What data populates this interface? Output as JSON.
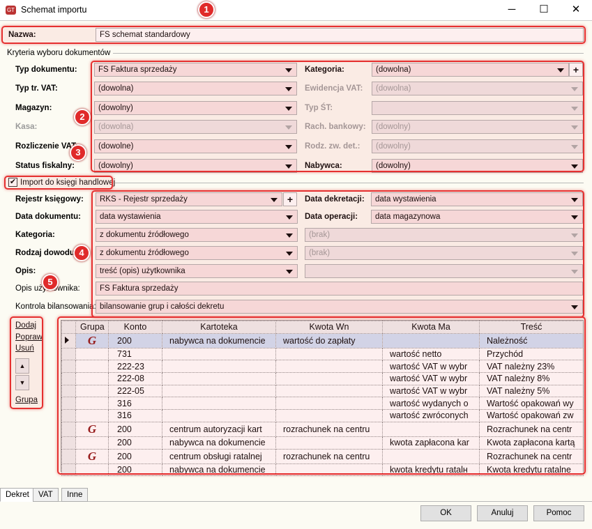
{
  "window": {
    "title": "Schemat importu",
    "minimize": "─",
    "maximize": "☐",
    "close": "✕"
  },
  "name": {
    "label": "Nazwa:",
    "value": "FS schemat standardowy"
  },
  "criteria": {
    "heading": "Kryteria wyboru dokumentów",
    "left": [
      {
        "label": "Typ dokumentu:",
        "value": "FS Faktura sprzedaży",
        "disabled": false
      },
      {
        "label": "Typ tr. VAT:",
        "value": "(dowolna)",
        "disabled": false
      },
      {
        "label": "Magazyn:",
        "value": "(dowolny)",
        "disabled": false
      },
      {
        "label": "Kasa:",
        "value": "(dowolna)",
        "disabled": true
      },
      {
        "label": "Rozliczenie VAT:",
        "value": "(dowolne)",
        "disabled": false
      },
      {
        "label": "Status fiskalny:",
        "value": "(dowolny)",
        "disabled": false
      }
    ],
    "right": [
      {
        "label": "Kategoria:",
        "value": "(dowolna)",
        "disabled": false
      },
      {
        "label": "Ewidencja VAT:",
        "value": "(dowolna)",
        "disabled": true
      },
      {
        "label": "Typ ŚT:",
        "value": "",
        "disabled": true
      },
      {
        "label": "Rach. bankowy:",
        "value": "(dowolny)",
        "disabled": true
      },
      {
        "label": "Rodz. zw. det.:",
        "value": "(dowolny)",
        "disabled": true
      },
      {
        "label": "Nabywca:",
        "value": "(dowolny)",
        "disabled": false
      }
    ],
    "plus": "+"
  },
  "import": {
    "label": "Import do księgi handlowej",
    "checked": true,
    "left": [
      {
        "label": "Rejestr księgowy:",
        "value": "RKS - Rejestr sprzedaży"
      },
      {
        "label": "Data dokumentu:",
        "value": "data wystawienia"
      },
      {
        "label": "Kategoria:",
        "value": "z dokumentu źródłowego"
      },
      {
        "label": "Rodzaj dowodu:",
        "value": "z dokumentu źródłowego"
      },
      {
        "label": "Opis:",
        "value": "treść (opis) użytkownika"
      }
    ],
    "right": [
      {
        "label": "Data dekretacji:",
        "value": "data wystawienia",
        "disabled": false
      },
      {
        "label": "Data operacji:",
        "value": "data magazynowa",
        "disabled": false
      },
      {
        "label": "",
        "value": "(brak)",
        "disabled": true
      },
      {
        "label": "",
        "value": "(brak)",
        "disabled": true
      },
      {
        "label": "",
        "value": "",
        "disabled": true
      }
    ],
    "user_desc": {
      "label": "Opis użytkownika:",
      "value": "FS Faktura sprzedaży"
    },
    "balance": {
      "label": "Kontrola bilansowania:",
      "value": "bilansowanie grup i całości dekretu"
    },
    "plus": "+"
  },
  "side_actions": {
    "add": "Dodaj",
    "edit": "Popraw",
    "delete": "Usuń",
    "up": "▲",
    "down": "▼",
    "group": "Grupa"
  },
  "table": {
    "columns": [
      "",
      "Grupa",
      "Konto",
      "Kartoteka",
      "Kwota Wn",
      "Kwota Ma",
      "Treść"
    ],
    "group_glyph": "G",
    "rows": [
      {
        "sel": true,
        "group": true,
        "konto": "200",
        "kartoteka": "nabywca na dokumencie",
        "wn": "wartość do zapłaty",
        "ma": "",
        "tresc": "Należność"
      },
      {
        "group": false,
        "konto": "731",
        "kartoteka": "",
        "wn": "",
        "ma": "wartość netto",
        "tresc": "Przychód"
      },
      {
        "group": false,
        "konto": "222-23",
        "kartoteka": "",
        "wn": "",
        "ma": "wartość VAT w wybr",
        "tresc": "VAT należny 23%"
      },
      {
        "group": false,
        "konto": "222-08",
        "kartoteka": "",
        "wn": "",
        "ma": "wartość VAT w wybr",
        "tresc": "VAT należny 8%"
      },
      {
        "group": false,
        "konto": "222-05",
        "kartoteka": "",
        "wn": "",
        "ma": "wartość VAT w wybr",
        "tresc": "VAT należny 5%"
      },
      {
        "group": false,
        "konto": "316",
        "kartoteka": "",
        "wn": "",
        "ma": "wartość wydanych o",
        "tresc": "Wartość opakowań wy"
      },
      {
        "group": false,
        "konto": "316",
        "kartoteka": "",
        "wn": "",
        "ma": "wartość zwróconych",
        "tresc": "Wartość opakowań zw"
      },
      {
        "group": true,
        "konto": "200",
        "kartoteka": "centrum autoryzacji kart",
        "wn": "rozrachunek na centru",
        "ma": "",
        "tresc": "Rozrachunek na centr"
      },
      {
        "group": false,
        "konto": "200",
        "kartoteka": "nabywca na dokumencie",
        "wn": "",
        "ma": "kwota zapłacona kar",
        "tresc": "Kwota zapłacona kartą"
      },
      {
        "group": true,
        "konto": "200",
        "kartoteka": "centrum obsługi ratalnej",
        "wn": "rozrachunek na centru",
        "ma": "",
        "tresc": "Rozrachunek na centr"
      },
      {
        "group": false,
        "konto": "200",
        "kartoteka": "nabywca na dokumencie",
        "wn": "",
        "ma": "kwota kredytu ratalн",
        "tresc": "Kwota kredytu ratalne"
      }
    ]
  },
  "tabs": [
    "Dekret",
    "VAT",
    "Inne"
  ],
  "buttons": {
    "ok": "OK",
    "cancel": "Anuluj",
    "help": "Pomoc"
  },
  "annotations": [
    "1",
    "2",
    "3",
    "4",
    "5"
  ],
  "colors": {
    "highlight": "#e53030",
    "selected_row": "#cfe0f5"
  }
}
